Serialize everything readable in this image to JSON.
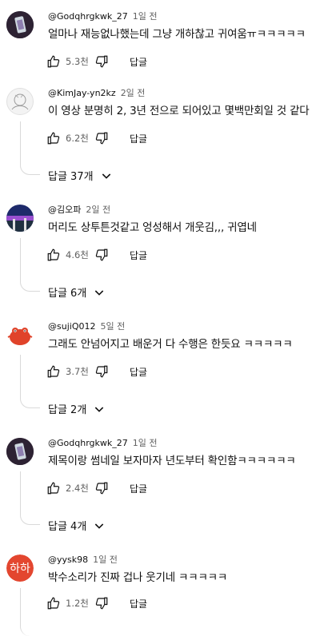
{
  "comments": [
    {
      "author": "@Godqhrgkwk_27",
      "time": "1일 전",
      "text": "얼마나 재능없나했는데 그냥 개하찮고 귀여움ㅠㅋㅋㅋㅋㅋ",
      "likes": "5.3천",
      "reply_label": "답글",
      "replies_label": ""
    },
    {
      "author": "@KimJay-yn2kz",
      "time": "2일 전",
      "text": "이 영상 분명히 2, 3년 전으로 되어있고 몇백만회일 것 같다",
      "likes": "6.2천",
      "reply_label": "답글",
      "replies_label": "답글 37개"
    },
    {
      "author": "@김오파",
      "time": "2일 전",
      "text": "머리도 상투튼것같고 엉성해서 개웃김,,, 귀엽네",
      "likes": "4.6천",
      "reply_label": "답글",
      "replies_label": "답글 6개"
    },
    {
      "author": "@sujiQ012",
      "time": "5일 전",
      "text": "그래도 안넘어지고 배운거 다 수행은 한듯요 ㅋㅋㅋㅋㅋ",
      "likes": "3.7천",
      "reply_label": "답글",
      "replies_label": "답글 2개"
    },
    {
      "author": "@Godqhrgkwk_27",
      "time": "1일 전",
      "text": "제목이랑 썸네일 보자마자 년도부터 확인함ㅋㅋㅋㅋㅋㅋ",
      "likes": "2.4천",
      "reply_label": "답글",
      "replies_label": "답글 4개"
    },
    {
      "author": "@yysk98",
      "time": "1일 전",
      "text": "박수소리가 진짜 겁나 웃기네 ㅋㅋㅋㅋㅋ",
      "likes": "1.2천",
      "reply_label": "답글",
      "replies_label": "",
      "avatar_text": "하하"
    }
  ],
  "colors": {
    "text": "#0f0f0f",
    "secondary": "#606060",
    "avatar_hh": "#e3462f"
  }
}
